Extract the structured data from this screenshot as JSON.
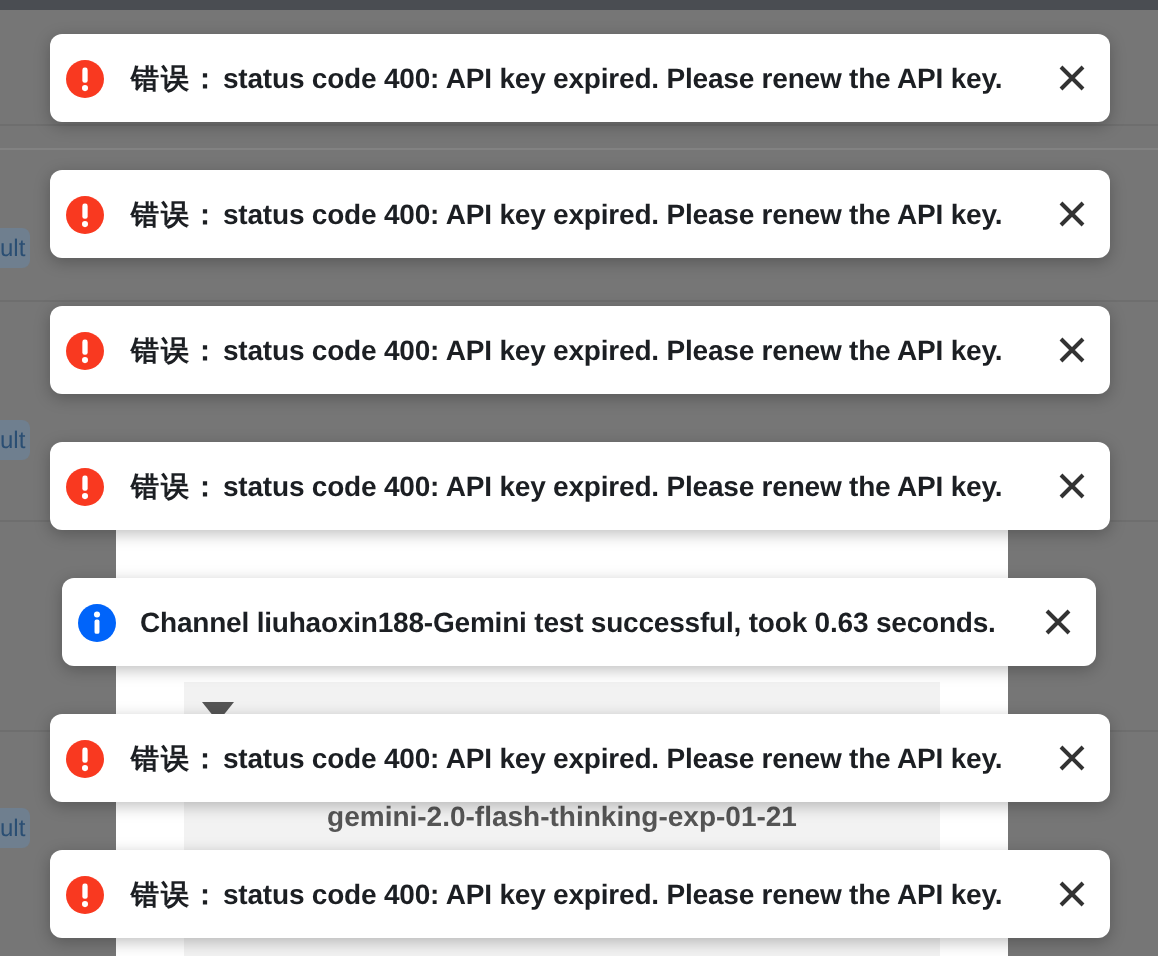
{
  "background": {
    "tags": [
      "ult",
      "ult",
      "ult"
    ],
    "model_option": "gemini-2.0-flash-thinking-exp-01-21"
  },
  "toasts": [
    {
      "kind": "error",
      "prefix": "错误：",
      "message": "status code 400: API key expired. Please renew the API key."
    },
    {
      "kind": "error",
      "prefix": "错误：",
      "message": "status code 400: API key expired. Please renew the API key."
    },
    {
      "kind": "error",
      "prefix": "错误：",
      "message": "status code 400: API key expired. Please renew the API key."
    },
    {
      "kind": "error",
      "prefix": "错误：",
      "message": "status code 400: API key expired. Please renew the API key."
    },
    {
      "kind": "info",
      "message": "Channel liuhaoxin188-Gemini test successful, took 0.63 seconds."
    },
    {
      "kind": "error",
      "prefix": "错误：",
      "message": "status code 400: API key expired. Please renew the API key."
    },
    {
      "kind": "error",
      "prefix": "错误：",
      "message": "status code 400: API key expired. Please renew the API key."
    }
  ]
}
